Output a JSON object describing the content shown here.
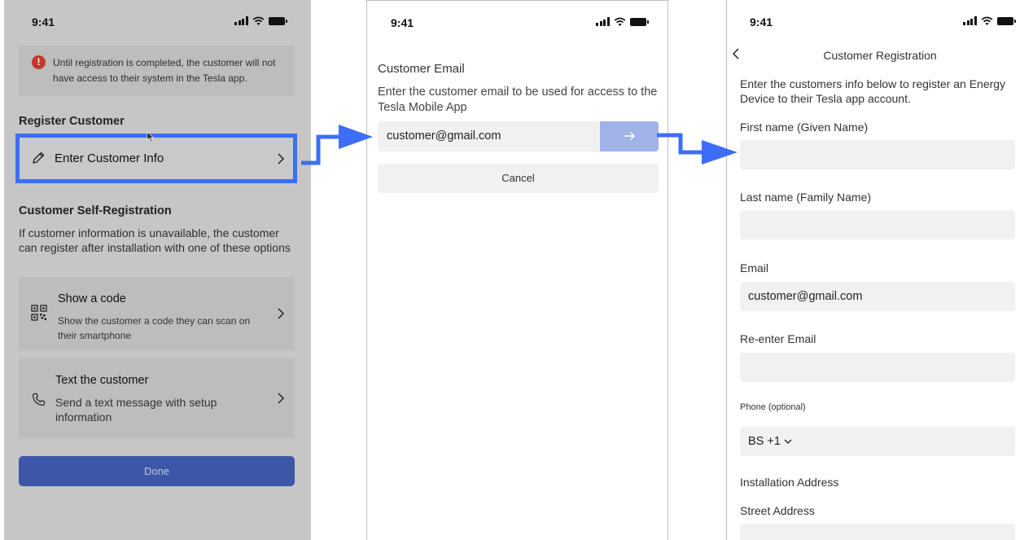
{
  "status_time": "9:41",
  "screen1": {
    "alert": "Until registration is completed, the customer will not have access to their system in the Tesla app.",
    "register_heading": "Register Customer",
    "enter_info": "Enter Customer Info",
    "self_reg_heading": "Customer Self-Registration",
    "self_reg_desc": "If customer information is unavailable, the customer can register after installation with one of these options",
    "show_code_title": "Show a code",
    "show_code_desc": "Show the customer a code they can scan on their smartphone",
    "text_title": "Text the customer",
    "text_desc": "Send a text message with setup information",
    "done": "Done"
  },
  "screen2": {
    "title": "Customer Email",
    "desc": "Enter the customer email to be used for access to the Tesla Mobile App",
    "email_value": "customer@gmail.com",
    "cancel": "Cancel"
  },
  "screen3": {
    "title": "Customer Registration",
    "intro": "Enter the customers info below to register an Energy Device to their Tesla app account.",
    "first_name_label": "First name (Given Name)",
    "first_name_value": "",
    "last_name_label": "Last name (Family Name)",
    "last_name_value": "",
    "email_label": "Email",
    "email_value": "customer@gmail.com",
    "reenter_label": "Re-enter Email",
    "reenter_value": "",
    "phone_label": "Phone (optional)",
    "phone_country": "BS +1",
    "install_heading": "Installation Address",
    "street_label": "Street Address"
  },
  "colors": {
    "highlight": "#3d6ef5",
    "done_button": "#3d57a8",
    "go_button": "#9fb3e7",
    "error": "#c2382b"
  }
}
